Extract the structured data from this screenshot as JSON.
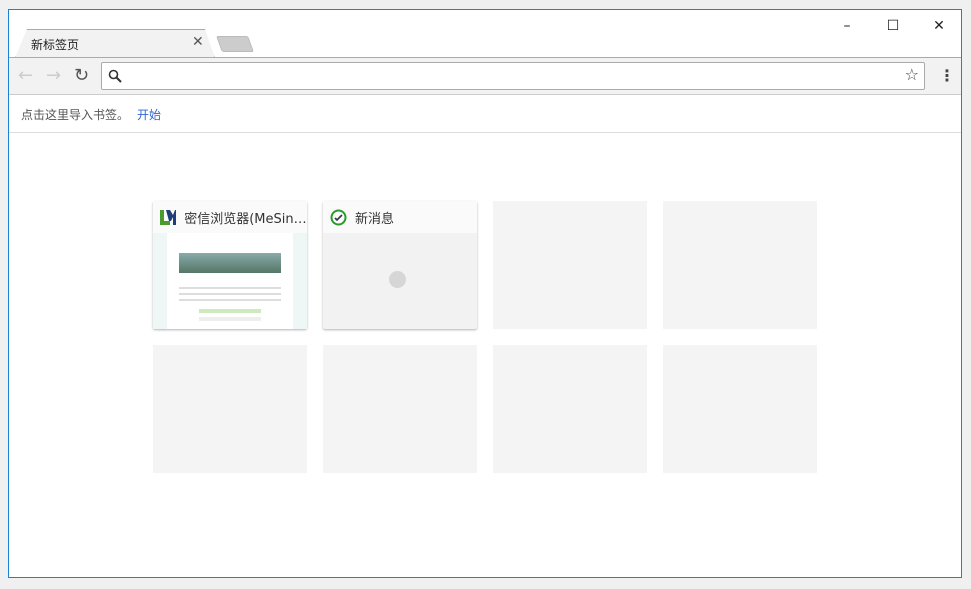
{
  "tab": {
    "title": "新标签页"
  },
  "window_controls": {
    "minimize": "–",
    "maximize": "☐",
    "close": "✕"
  },
  "bookmarks_bar": {
    "text": "点击这里导入书签。",
    "link": "开始"
  },
  "omnibox": {
    "value": "",
    "placeholder": ""
  },
  "tiles": [
    {
      "title": "密信浏览器(MeSinc...",
      "icon": "mesign-logo-icon"
    },
    {
      "title": "新消息",
      "icon": "check-circle-icon",
      "loading": true
    }
  ],
  "colors": {
    "accent": "#1883d7",
    "link": "#3367d6"
  }
}
